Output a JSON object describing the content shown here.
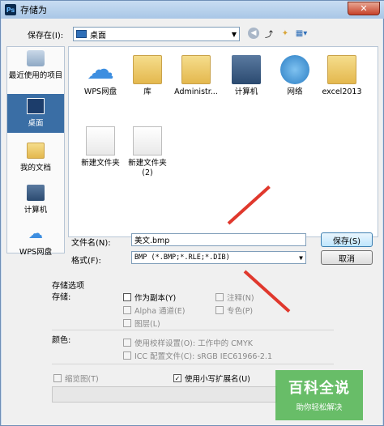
{
  "window": {
    "title": "存储为",
    "app_badge": "Ps",
    "close": "✕"
  },
  "location": {
    "label": "保存在(I):",
    "value": "桌面"
  },
  "sidebar": [
    {
      "label": "最近使用的项目"
    },
    {
      "label": "桌面"
    },
    {
      "label": "我的文档"
    },
    {
      "label": "计算机"
    },
    {
      "label": "WPS网盘"
    }
  ],
  "files": [
    {
      "name": "WPS网盘"
    },
    {
      "name": "库"
    },
    {
      "name": "Administr..."
    },
    {
      "name": "计算机"
    },
    {
      "name": "网络"
    },
    {
      "name": "excel2013"
    },
    {
      "name": "新建文件夹"
    },
    {
      "name": "新建文件夹 (2)"
    }
  ],
  "filename": {
    "label": "文件名(N):",
    "value": "美文.bmp"
  },
  "format": {
    "label": "格式(F):",
    "value": "BMP (*.BMP;*.RLE;*.DIB)"
  },
  "buttons": {
    "save": "保存(S)",
    "cancel": "取消"
  },
  "options": {
    "title": "存储选项",
    "store_label": "存储:",
    "as_copy": "作为副本(Y)",
    "notes": "注释(N)",
    "alpha": "Alpha 通道(E)",
    "spot": "专色(P)",
    "layers": "图层(L)",
    "color_label": "颜色:",
    "proof": "使用校样设置(O): 工作中的 CMYK",
    "icc": "ICC 配置文件(C): sRGB IEC61966-2.1",
    "thumbnail": "缩览图(T)",
    "lowercase_ext": "使用小写扩展名(U)"
  },
  "watermark": {
    "line1": "百科全说",
    "line2": "助你轻松解决"
  },
  "colors": {
    "accent": "#3a6ea5",
    "arrow": "#e0382d",
    "watermark": "#4cb24c"
  }
}
